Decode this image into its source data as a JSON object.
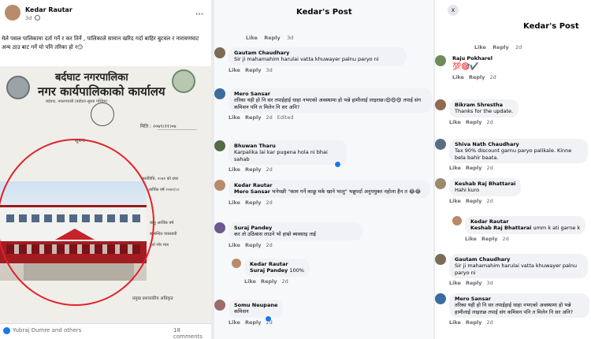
{
  "post": {
    "author": "Kedar Rautar",
    "time": "3d ·",
    "menu": "···",
    "text": "मेले पसल पालिकामा दर्ता गर्ने र कर तिर्ने , पालिकाले सामान खरिद गर्दा बाहिर बुटवल र नारायणघाट अन्य ठाउ बाट गर्ने यो पनि तरिका हो र😏",
    "doc_heading1": "बर्दघाट नगरपालिका",
    "doc_heading2": "नगर कार्यपालिकाको कार्यालय",
    "doc_subline": "बर्दघाट, नवलपरासी (बर्दघाट-सुस्ता पश्चिम)",
    "doc_date": "मिति : २०७९।११।०७",
    "doc_notice": "सूचना",
    "doc_text1": "कार्यविधि, २०७१ को दफा",
    "doc_text2": "आर्थिक वर्ष २०७९/८०",
    "doc_text3": "चालु आर्थिक वर्ष",
    "doc_text4": "सम्बन्धित व्यवसायी",
    "doc_text5": "दर्ता गरेर मात्र",
    "doc_sign": "प्रमुख प्रशासकीय अधिकृत",
    "reactors": "Yubraj Dumre and others",
    "comments_count": "18 comments"
  },
  "middle": {
    "title": "Kedar's Post",
    "top_actions": {
      "like": "Like",
      "reply": "Reply",
      "time": "3d"
    },
    "comments": [
      {
        "name": "Gautam Chaudhary",
        "text": "Sir ji mahamahim harulai vatta khuwayer palnu paryo ni",
        "time": "3d",
        "edited": ""
      },
      {
        "name": "Mero Sansar",
        "text": "तरिका यही हो नि सर तपाईहाई धाहा नभएको अवस्थामा हो भन्ने हामीलाई लाइराछ।😄😄😄 तपाई संग कमिसन पनि त मिलेन नि सर अनि?",
        "time": "2d",
        "edited": "Edited"
      },
      {
        "name": "Bhuwan Tharu",
        "text": "Karpalika lai kar pugena hola ni bhai sahab",
        "time": "2d",
        "edited": ""
      },
      {
        "name": "Kedar Rautar",
        "mention": "Mero Sansar",
        "text": " भनेपछी \"काम गर्ने काछु मके खाने भालु\" भन्नुपर्दा अनुपयुक्त नहोला हैन त 😂😂",
        "time": "2d",
        "edited": ""
      },
      {
        "name": "Suraj Pandey",
        "text": "कर तो उठिबास लाउने भो हाम्रो ब्यवसाइ ताई",
        "time": "2d",
        "edited": ""
      },
      {
        "name": "Kedar Rautar",
        "mention": "Suraj Pandey",
        "text": " 100%",
        "time": "2d",
        "edited": ""
      },
      {
        "name": "Somu Neupane",
        "text": "कमिसन",
        "time": "2d",
        "edited": ""
      }
    ],
    "like": "Like",
    "reply": "Reply"
  },
  "right": {
    "close": "x",
    "title": "Kedar's Post",
    "top_actions": {
      "like": "Like",
      "reply": "Reply",
      "time": "2d"
    },
    "comments": [
      {
        "name": "Raju Pokharel",
        "text": "💯🎯✔️",
        "time": "2d"
      },
      {
        "name": "Bikram Shrestha",
        "text": "Thanks for the update.",
        "time": "2d"
      },
      {
        "name": "Shiva Nath Chaudhary",
        "text": "Tax 90% discount garnu paryo palikale. Kinne bela bahir baata.",
        "time": "2d"
      },
      {
        "name": "Keshab Raj Bhattarai",
        "text": "Hahi kuro",
        "time": "2d"
      },
      {
        "name": "Kedar Rautar",
        "mention": "Keshab Raj Bhattarai",
        "text": " umm k ati garne k",
        "time": "2d"
      },
      {
        "name": "Gautam Chaudhary",
        "text": "Sir ji mahamahim harulai vatta khuwayer palnu paryo ni",
        "time": "3d"
      },
      {
        "name": "Mero Sansar",
        "text": "तरिका यही हो नि सर तपाईहाई धाहा नभएको अवस्थामा हो भन्ने हामीलाई लाइराछ तपाई संग कमिसन पनि त मिलेन नि सर अनि?",
        "time": "2d"
      }
    ],
    "like": "Like",
    "reply": "Reply"
  },
  "colors": {
    "accent": "#1877f2",
    "bubble": "#f0f2f5",
    "circle": "#e0232a"
  }
}
